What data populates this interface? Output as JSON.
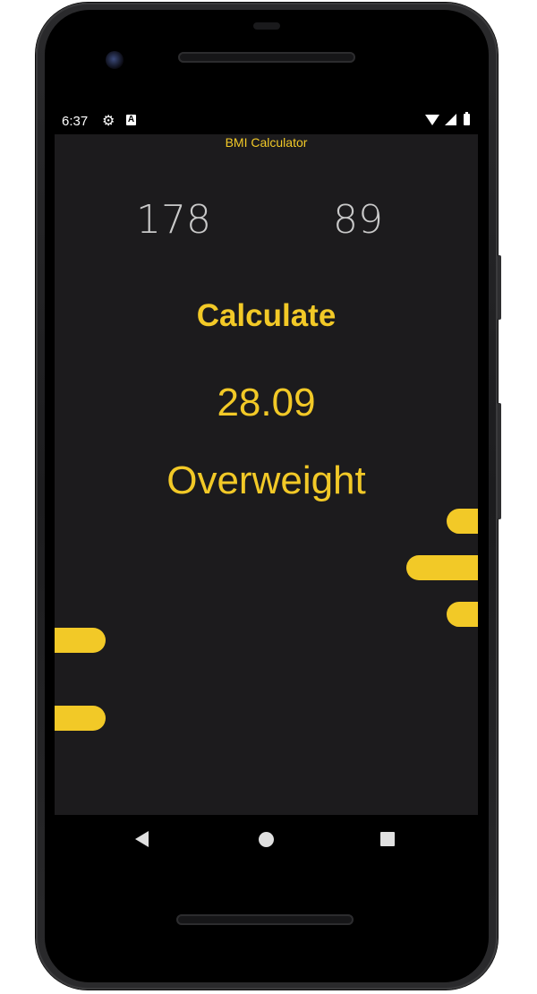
{
  "status_bar": {
    "time": "6:37",
    "icons": [
      "gear-icon",
      "a-icon",
      "wifi-icon",
      "signal-icon",
      "battery-icon"
    ]
  },
  "app": {
    "title": "BMI Calculator",
    "height_value": "178",
    "weight_value": "89",
    "calculate_label": "Calculate",
    "bmi_result": "28.09",
    "bmi_category": "Overweight"
  },
  "nav_bar": {
    "icons": [
      "back-icon",
      "home-icon",
      "recents-icon"
    ]
  },
  "colors": {
    "accent": "#f2c927",
    "background": "#1c1b1d",
    "number_text": "#c9c9c9"
  }
}
